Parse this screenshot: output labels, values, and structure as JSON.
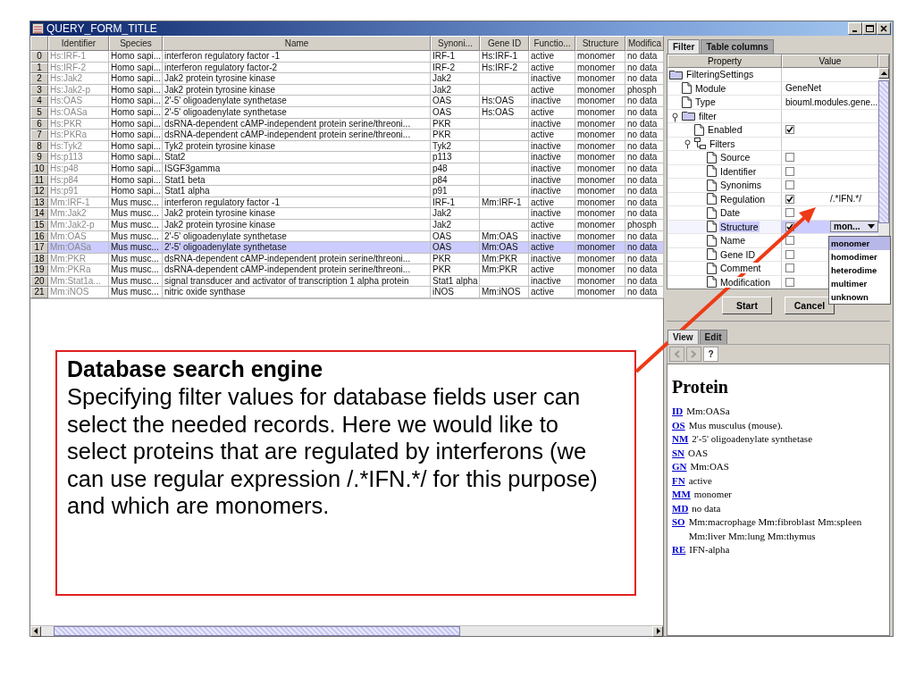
{
  "window": {
    "title": "QUERY_FORM_TITLE"
  },
  "table": {
    "columns": [
      "Identifier",
      "Species",
      "Name",
      "Synoni...",
      "Gene ID",
      "Functio...",
      "Structure",
      "Modifica"
    ],
    "rows": [
      {
        "number": "0",
        "selected": false,
        "cells": [
          "Hs:IRF-1",
          "Homo sapi...",
          "interferon regulatory factor -1",
          "IRF-1",
          "Hs:IRF-1",
          "active",
          "monomer",
          "no data"
        ]
      },
      {
        "number": "1",
        "selected": false,
        "cells": [
          "Hs:IRF-2",
          "Homo sapi...",
          "interferon regulatory factor-2",
          "IRF-2",
          "Hs:IRF-2",
          "active",
          "monomer",
          "no data"
        ]
      },
      {
        "number": "2",
        "selected": false,
        "cells": [
          "Hs:Jak2",
          "Homo sapi...",
          "Jak2 protein tyrosine kinase",
          "Jak2",
          null,
          "inactive",
          "monomer",
          "no data"
        ]
      },
      {
        "number": "3",
        "selected": false,
        "cells": [
          "Hs:Jak2-p",
          "Homo sapi...",
          "Jak2 protein tyrosine kinase",
          "Jak2",
          null,
          "active",
          "monomer",
          "phosph"
        ]
      },
      {
        "number": "4",
        "selected": false,
        "cells": [
          "Hs:OAS",
          "Homo sapi...",
          "2'-5' oligoadenylate synthetase",
          "OAS",
          "Hs:OAS",
          "inactive",
          "monomer",
          "no data"
        ]
      },
      {
        "number": "5",
        "selected": false,
        "cells": [
          "Hs:OASa",
          "Homo sapi...",
          "2'-5' oligoadenylate synthetase",
          "OAS",
          "Hs:OAS",
          "active",
          "monomer",
          "no data"
        ]
      },
      {
        "number": "6",
        "selected": false,
        "cells": [
          "Hs:PKR",
          "Homo sapi...",
          "dsRNA-dependent cAMP-independent protein serine/threoni...",
          "PKR",
          null,
          "inactive",
          "monomer",
          "no data"
        ]
      },
      {
        "number": "7",
        "selected": false,
        "cells": [
          "Hs:PKRa",
          "Homo sapi...",
          "dsRNA-dependent cAMP-independent protein serine/threoni...",
          "PKR",
          null,
          "active",
          "monomer",
          "no data"
        ]
      },
      {
        "number": "8",
        "selected": false,
        "cells": [
          "Hs:Tyk2",
          "Homo sapi...",
          "Tyk2 protein tyrosine kinase",
          "Tyk2",
          null,
          "inactive",
          "monomer",
          "no data"
        ]
      },
      {
        "number": "9",
        "selected": false,
        "cells": [
          "Hs:p113",
          "Homo sapi...",
          "Stat2",
          "p113",
          null,
          "inactive",
          "monomer",
          "no data"
        ]
      },
      {
        "number": "10",
        "selected": false,
        "cells": [
          "Hs:p48",
          "Homo sapi...",
          "ISGF3gamma",
          "p48",
          null,
          "inactive",
          "monomer",
          "no data"
        ]
      },
      {
        "number": "11",
        "selected": false,
        "cells": [
          "Hs:p84",
          "Homo sapi...",
          "Stat1 beta",
          "p84",
          null,
          "inactive",
          "monomer",
          "no data"
        ]
      },
      {
        "number": "12",
        "selected": false,
        "cells": [
          "Hs:p91",
          "Homo sapi...",
          "Stat1 alpha",
          "p91",
          null,
          "inactive",
          "monomer",
          "no data"
        ]
      },
      {
        "number": "13",
        "selected": false,
        "cells": [
          "Mm:IRF-1",
          "Mus musc...",
          "interferon regulatory factor -1",
          "IRF-1",
          "Mm:IRF-1",
          "active",
          "monomer",
          "no data"
        ]
      },
      {
        "number": "14",
        "selected": false,
        "cells": [
          "Mm:Jak2",
          "Mus musc...",
          "Jak2 protein tyrosine kinase",
          "Jak2",
          null,
          "inactive",
          "monomer",
          "no data"
        ]
      },
      {
        "number": "15",
        "selected": false,
        "cells": [
          "Mm:Jak2-p",
          "Mus musc...",
          "Jak2 protein tyrosine kinase",
          "Jak2",
          null,
          "active",
          "monomer",
          "phosph"
        ]
      },
      {
        "number": "16",
        "selected": false,
        "cells": [
          "Mm:OAS",
          "Mus musc...",
          "2'-5' oligoadenylate synthetase",
          "OAS",
          "Mm:OAS",
          "inactive",
          "monomer",
          "no data"
        ]
      },
      {
        "number": "17",
        "selected": true,
        "cells": [
          "Mm:OASa",
          "Mus musc...",
          "2'-5' oligoadenylate synthetase",
          "OAS",
          "Mm:OAS",
          "active",
          "monomer",
          "no data"
        ]
      },
      {
        "number": "18",
        "selected": false,
        "cells": [
          "Mm:PKR",
          "Mus musc...",
          "dsRNA-dependent cAMP-independent protein serine/threoni...",
          "PKR",
          "Mm:PKR",
          "inactive",
          "monomer",
          "no data"
        ]
      },
      {
        "number": "19",
        "selected": false,
        "cells": [
          "Mm:PKRa",
          "Mus musc...",
          "dsRNA-dependent cAMP-independent protein serine/threoni...",
          "PKR",
          "Mm:PKR",
          "active",
          "monomer",
          "no data"
        ]
      },
      {
        "number": "20",
        "selected": false,
        "cells": [
          "Mm:Stat1a...",
          "Mus musc...",
          "signal transducer and activator of transcription 1 alpha protein",
          "Stat1 alpha",
          null,
          "inactive",
          "monomer",
          "no data"
        ]
      },
      {
        "number": "21",
        "selected": false,
        "cells": [
          "Mm:iNOS",
          "Mus musc...",
          "nitric oxide synthase",
          "iNOS",
          "Mm:iNOS",
          "active",
          "monomer",
          "no data"
        ]
      }
    ]
  },
  "filter_panel": {
    "tabs": [
      {
        "label": "Filter",
        "selected": true
      },
      {
        "label": "Table columns",
        "selected": false
      }
    ],
    "columns": [
      "Property",
      "Value"
    ],
    "tree": [
      {
        "label": "FilteringSettings",
        "kind": "folder",
        "selected": false,
        "children": [
          {
            "label": "Module",
            "kind": "page",
            "selected": false,
            "value": "GeneNet"
          },
          {
            "label": "Type",
            "kind": "page",
            "selected": false,
            "value": "biouml.modules.gene..."
          },
          {
            "label": "filter",
            "kind": "folder",
            "selected": false,
            "expanded": true,
            "children": [
              {
                "label": "Enabled",
                "kind": "page",
                "selected": false,
                "checked": true
              },
              {
                "label": "Filters",
                "kind": "group",
                "selected": false,
                "expanded": true,
                "children": [
                  {
                    "label": "Source",
                    "kind": "page",
                    "selected": false,
                    "checked": false
                  },
                  {
                    "label": "Identifier",
                    "kind": "page",
                    "selected": false,
                    "checked": false
                  },
                  {
                    "label": "Synonims",
                    "kind": "page",
                    "selected": false,
                    "checked": false
                  },
                  {
                    "label": "Regulation",
                    "kind": "page",
                    "selected": false,
                    "checked": true,
                    "value": "/.*IFN.*/"
                  },
                  {
                    "label": "Date",
                    "kind": "page",
                    "selected": false,
                    "checked": false
                  },
                  {
                    "label": "Structure",
                    "kind": "page",
                    "selected": true,
                    "checked": true,
                    "combo": "mon..."
                  },
                  {
                    "label": "Name",
                    "kind": "page",
                    "selected": false,
                    "checked": false
                  },
                  {
                    "label": "Gene ID",
                    "kind": "page",
                    "selected": false,
                    "checked": false
                  },
                  {
                    "label": "Comment",
                    "kind": "page",
                    "selected": false,
                    "checked": false
                  },
                  {
                    "label": "Modification",
                    "kind": "page",
                    "selected": false,
                    "checked": false
                  }
                ]
              }
            ]
          }
        ]
      }
    ],
    "dropdown_options": [
      {
        "label": "monomer",
        "selected": true
      },
      {
        "label": "homodimer",
        "selected": false
      },
      {
        "label": "heterodime",
        "selected": false
      },
      {
        "label": "multimer",
        "selected": false
      },
      {
        "label": "unknown",
        "selected": false
      }
    ],
    "buttons": [
      "Start",
      "Cancel"
    ]
  },
  "viewer": {
    "tabs": [
      {
        "label": "View",
        "selected": true
      },
      {
        "label": "Edit",
        "selected": false
      }
    ],
    "toolbar": [
      {
        "kind": "back",
        "disabled": true
      },
      {
        "kind": "forward",
        "disabled": true
      },
      {
        "kind": "help",
        "label": "?",
        "disabled": false
      }
    ],
    "title": "Protein",
    "fields": [
      {
        "key": "ID",
        "value": "Mm:OASa"
      },
      {
        "key": "OS",
        "value": "Mus musculus (mouse)."
      },
      {
        "key": "NM",
        "value": "2'-5' oligoadenylate synthetase"
      },
      {
        "key": "SN",
        "value": "OAS"
      },
      {
        "key": "GN",
        "value": "Mm:OAS"
      },
      {
        "key": "FN",
        "value": "active"
      },
      {
        "key": "MM",
        "value": "monomer"
      },
      {
        "key": "MD",
        "value": "no data"
      },
      {
        "key": "SO",
        "value": "Mm:macrophage Mm:fibroblast Mm:spleen Mm:liver Mm:lung Mm:thymus"
      },
      {
        "key": "RE",
        "value": "IFN-alpha"
      }
    ]
  },
  "callout": {
    "title": "Database search engine",
    "text": "Specifying filter values for database fields user can select the needed records. Here we would like to select proteins that are regulated by interferons (we can use regular expression /.*IFN.*/ for this purpose) and which are monomers."
  }
}
